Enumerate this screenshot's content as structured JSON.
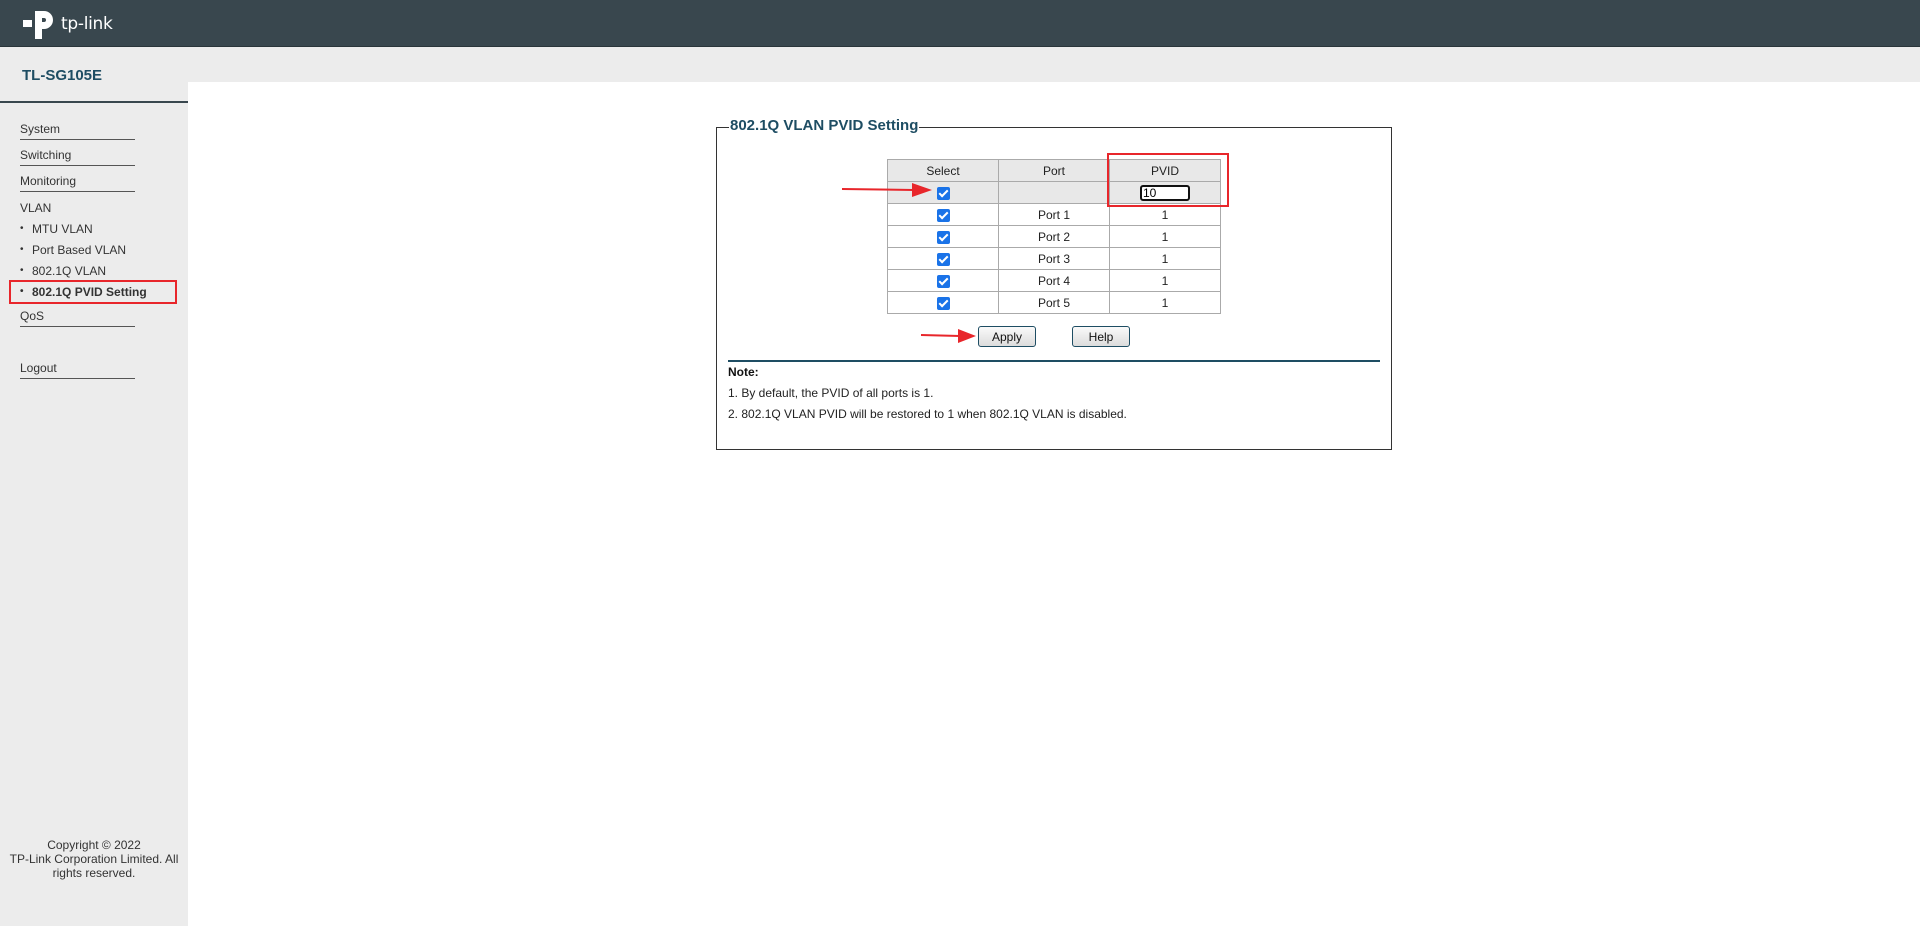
{
  "header": {
    "logo_text": "tp-link"
  },
  "sidebar": {
    "model": "TL-SG105E",
    "nav": [
      {
        "label": "System"
      },
      {
        "label": "Switching"
      },
      {
        "label": "Monitoring"
      },
      {
        "label": "VLAN"
      }
    ],
    "vlan_sub": [
      {
        "label": "MTU VLAN"
      },
      {
        "label": "Port Based VLAN"
      },
      {
        "label": "802.1Q VLAN"
      },
      {
        "label": "802.1Q PVID Setting",
        "active": true
      }
    ],
    "qos": "QoS",
    "logout": "Logout",
    "copyright_line1": "Copyright © 2022",
    "copyright_line2": "TP-Link Corporation Limited. All rights reserved."
  },
  "panel": {
    "title": "802.1Q VLAN PVID Setting",
    "columns": [
      "Select",
      "Port",
      "PVID"
    ],
    "select_all_pvid_value": "10",
    "rows": [
      {
        "port": "Port 1",
        "pvid": "1",
        "selected": true
      },
      {
        "port": "Port 2",
        "pvid": "1",
        "selected": true
      },
      {
        "port": "Port 3",
        "pvid": "1",
        "selected": true
      },
      {
        "port": "Port 4",
        "pvid": "1",
        "selected": true
      },
      {
        "port": "Port 5",
        "pvid": "1",
        "selected": true
      }
    ],
    "apply_label": "Apply",
    "help_label": "Help",
    "note_title": "Note:",
    "notes": [
      "1. By default, the PVID of all ports is 1.",
      "2. 802.1Q VLAN PVID will be restored to 1 when 802.1Q VLAN is disabled."
    ]
  },
  "colors": {
    "header_bg": "#39474e",
    "accent": "#1e4d63",
    "highlight": "#e8262b",
    "checkbox": "#1a73e8"
  }
}
